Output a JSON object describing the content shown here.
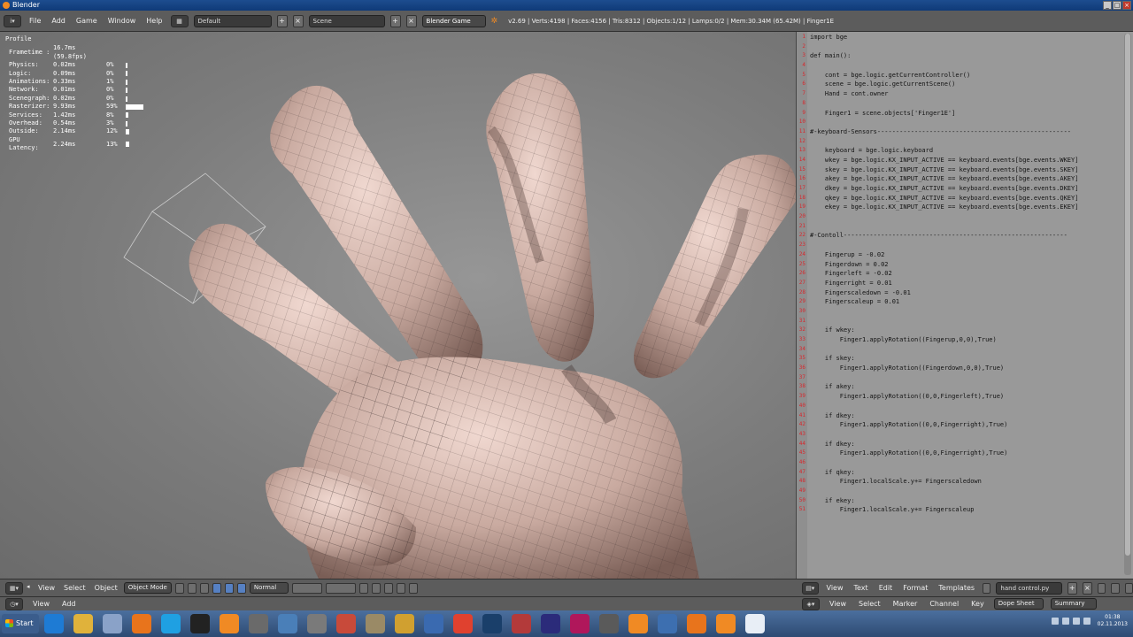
{
  "window": {
    "title": "Blender",
    "buttons": [
      "_",
      "□",
      "×"
    ]
  },
  "info_header": {
    "menus": [
      "File",
      "Add",
      "Game",
      "Window",
      "Help"
    ],
    "screen": "Default",
    "scene": "Scene",
    "engine": "Blender Game",
    "stats": "v2.69 | Verts:4198 | Faces:4156 | Tris:8312 | Objects:1/12 | Lamps:0/2 | Mem:30.34M (65.42M) | Finger1E"
  },
  "profile": {
    "title": "Profile",
    "rows": [
      {
        "name": "Frametime :",
        "time": "16.7ms (59.8fps)",
        "pct": "",
        "bar": 0
      },
      {
        "name": "Physics:",
        "time": "0.02ms",
        "pct": "0%",
        "bar": 0.005
      },
      {
        "name": "Logic:",
        "time": "0.09ms",
        "pct": "0%",
        "bar": 0.005
      },
      {
        "name": "Animations:",
        "time": "0.33ms",
        "pct": "1%",
        "bar": 0.01
      },
      {
        "name": "Network:",
        "time": "0.01ms",
        "pct": "0%",
        "bar": 0.005
      },
      {
        "name": "Scenegraph:",
        "time": "0.02ms",
        "pct": "0%",
        "bar": 0.005
      },
      {
        "name": "Rasterizer:",
        "time": "9.93ms",
        "pct": "59%",
        "bar": 0.59
      },
      {
        "name": "Services:",
        "time": "1.42ms",
        "pct": "8%",
        "bar": 0.08
      },
      {
        "name": "Overhead:",
        "time": "0.54ms",
        "pct": "3%",
        "bar": 0.03
      },
      {
        "name": "Outside:",
        "time": "2.14ms",
        "pct": "12%",
        "bar": 0.12
      },
      {
        "name": "GPU Latency:",
        "time": "2.24ms",
        "pct": "13%",
        "bar": 0.13
      }
    ]
  },
  "code": {
    "lines": [
      {
        "n": "1",
        "t": "import bge"
      },
      {
        "n": "2",
        "t": ""
      },
      {
        "n": "3",
        "t": "def main():"
      },
      {
        "n": "4",
        "t": ""
      },
      {
        "n": "5",
        "t": "    cont = bge.logic.getCurrentController()"
      },
      {
        "n": "6",
        "t": "    scene = bge.logic.getCurrentScene()"
      },
      {
        "n": "7",
        "t": "    Hand = cont.owner"
      },
      {
        "n": "8",
        "t": ""
      },
      {
        "n": "9",
        "t": "    Finger1 = scene.objects['Finger1E']"
      },
      {
        "n": "10",
        "t": ""
      },
      {
        "n": "11",
        "t": "#-keyboard-Sensors----------------------------------------------------"
      },
      {
        "n": "12",
        "t": ""
      },
      {
        "n": "13",
        "t": "    keyboard = bge.logic.keyboard"
      },
      {
        "n": "14",
        "t": "    wkey = bge.logic.KX_INPUT_ACTIVE == keyboard.events[bge.events.WKEY]"
      },
      {
        "n": "15",
        "t": "    skey = bge.logic.KX_INPUT_ACTIVE == keyboard.events[bge.events.SKEY]"
      },
      {
        "n": "16",
        "t": "    akey = bge.logic.KX_INPUT_ACTIVE == keyboard.events[bge.events.AKEY]"
      },
      {
        "n": "17",
        "t": "    dkey = bge.logic.KX_INPUT_ACTIVE == keyboard.events[bge.events.DKEY]"
      },
      {
        "n": "18",
        "t": "    qkey = bge.logic.KX_INPUT_ACTIVE == keyboard.events[bge.events.QKEY]"
      },
      {
        "n": "19",
        "t": "    ekey = bge.logic.KX_INPUT_ACTIVE == keyboard.events[bge.events.EKEY]"
      },
      {
        "n": "20",
        "t": ""
      },
      {
        "n": "21",
        "t": ""
      },
      {
        "n": "22",
        "t": "#-Contoll------------------------------------------------------------"
      },
      {
        "n": "23",
        "t": ""
      },
      {
        "n": "24",
        "t": "    Fingerup = -0.02"
      },
      {
        "n": "25",
        "t": "    Fingerdown = 0.02"
      },
      {
        "n": "26",
        "t": "    Fingerleft = -0.02"
      },
      {
        "n": "27",
        "t": "    Fingerright = 0.01"
      },
      {
        "n": "28",
        "t": "    Fingerscaledown = -0.01"
      },
      {
        "n": "29",
        "t": "    Fingerscaleup = 0.01"
      },
      {
        "n": "30",
        "t": ""
      },
      {
        "n": "31",
        "t": ""
      },
      {
        "n": "32",
        "t": "    if wkey:"
      },
      {
        "n": "33",
        "t": "        Finger1.applyRotation((Fingerup,0,0),True)"
      },
      {
        "n": "34",
        "t": ""
      },
      {
        "n": "35",
        "t": "    if skey:"
      },
      {
        "n": "36",
        "t": "        Finger1.applyRotation((Fingerdown,0,0),True)"
      },
      {
        "n": "37",
        "t": ""
      },
      {
        "n": "38",
        "t": "    if akey:"
      },
      {
        "n": "39",
        "t": "        Finger1.applyRotation((0,0,Fingerleft),True)"
      },
      {
        "n": "40",
        "t": ""
      },
      {
        "n": "41",
        "t": "    if dkey:"
      },
      {
        "n": "42",
        "t": "        Finger1.applyRotation((0,0,Fingerright),True)"
      },
      {
        "n": "43",
        "t": ""
      },
      {
        "n": "44",
        "t": "    if dkey:"
      },
      {
        "n": "45",
        "t": "        Finger1.applyRotation((0,0,Fingerright),True)"
      },
      {
        "n": "46",
        "t": ""
      },
      {
        "n": "47",
        "t": "    if qkey:"
      },
      {
        "n": "48",
        "t": "        Finger1.localScale.y+= Fingerscaledown"
      },
      {
        "n": "49",
        "t": ""
      },
      {
        "n": "50",
        "t": "    if ekey:"
      },
      {
        "n": "51",
        "t": "        Finger1.localScale.y+= Fingerscaleup"
      }
    ]
  },
  "viewport_header": {
    "menus": [
      "View",
      "Select",
      "Object"
    ],
    "mode": "Object Mode",
    "pivot": "Normal"
  },
  "text_header": {
    "menus": [
      "View",
      "Text",
      "Edit",
      "Format",
      "Templates"
    ],
    "filename": "hand control.py"
  },
  "timeline_header": {
    "menus": [
      "View",
      "Add"
    ]
  },
  "dopesheet_header": {
    "menus": [
      "View",
      "Select",
      "Marker",
      "Channel",
      "Key"
    ],
    "mode": "Dope Sheet",
    "summary": "Summary"
  },
  "taskbar": {
    "start": "Start",
    "icons": [
      "ie-icon",
      "folder-icon",
      "media-icon",
      "firefox-icon",
      "skype-icon",
      "headphones-icon",
      "vlc-icon",
      "archive-icon",
      "network-icon",
      "tools-icon",
      "calendar-icon",
      "gimp-icon",
      "paint-icon",
      "settings-icon",
      "chrome-icon",
      "steam-icon",
      "filezilla-icon",
      "photoshop-icon",
      "indesign-icon",
      "usb-icon",
      "blender-icon",
      "bs-icon",
      "firefox-icon-2",
      "blender-active-icon",
      "file-icon"
    ],
    "time": "01:38",
    "date": "02.11.2013"
  }
}
